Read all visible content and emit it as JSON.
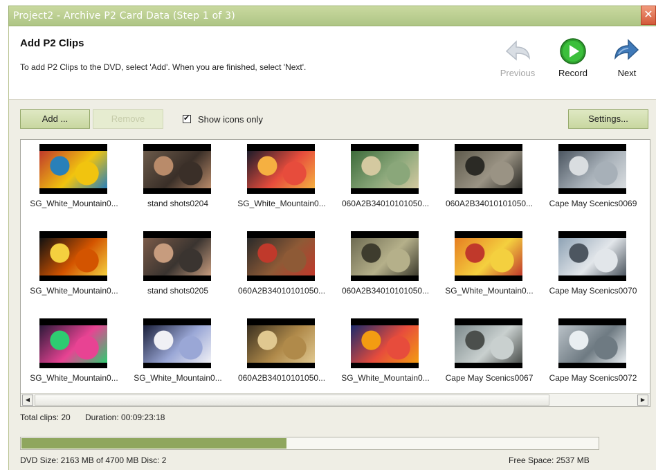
{
  "window": {
    "title": "Project2 - Archive P2 Card Data (Step 1 of 3)",
    "close_glyph": "✕"
  },
  "header": {
    "heading": "Add P2 Clips",
    "instructions": "To add P2 Clips to the DVD, select 'Add'. When you are finished, select 'Next'.",
    "nav": {
      "previous": {
        "label": "Previous",
        "icon": "left-arrow-icon",
        "enabled": false
      },
      "record": {
        "label": "Record",
        "icon": "record-play-icon",
        "enabled": true
      },
      "next": {
        "label": "Next",
        "icon": "right-arrow-icon",
        "enabled": true
      }
    }
  },
  "toolbar": {
    "add_label": "Add ...",
    "remove_label": "Remove",
    "show_icons_label": "Show icons only",
    "show_icons_checked": true,
    "settings_label": "Settings..."
  },
  "clips": [
    {
      "name": "SG_White_Mountain0...",
      "palette": [
        "#c0392b",
        "#f1c40f",
        "#2980b9"
      ]
    },
    {
      "name": "stand shots0204",
      "palette": [
        "#6b5a4a",
        "#3a2f28",
        "#b98b6a"
      ]
    },
    {
      "name": "SG_White_Mountain0...",
      "palette": [
        "#1c1c2a",
        "#e74c3c",
        "#f5b041"
      ]
    },
    {
      "name": "060A2B34010101050...",
      "palette": [
        "#3d6b3a",
        "#8aa77a",
        "#d4c9a0"
      ]
    },
    {
      "name": "060A2B34010101050...",
      "palette": [
        "#5e5a4c",
        "#9a9384",
        "#2b2a25"
      ]
    },
    {
      "name": "Cape May Scenics0069",
      "palette": [
        "#4b5560",
        "#a7b0b8",
        "#d9dde0"
      ]
    },
    {
      "name": "SG_White_Mountain0...",
      "palette": [
        "#111111",
        "#d35400",
        "#f4d03f"
      ]
    },
    {
      "name": "stand shots0205",
      "palette": [
        "#7a5a48",
        "#3a3430",
        "#c79c7e"
      ]
    },
    {
      "name": "060A2B34010101050...",
      "palette": [
        "#2a2a2a",
        "#8e5a36",
        "#c0392b"
      ]
    },
    {
      "name": "060A2B34010101050...",
      "palette": [
        "#6e6b52",
        "#b5b08a",
        "#3e3c2e"
      ]
    },
    {
      "name": "SG_White_Mountain0...",
      "palette": [
        "#e67e22",
        "#f4d03f",
        "#c0392b"
      ]
    },
    {
      "name": "Cape May Scenics0070",
      "palette": [
        "#8fa3b5",
        "#e2e6ea",
        "#4d5660"
      ]
    },
    {
      "name": "SG_White_Mountain0...",
      "palette": [
        "#2c1a3a",
        "#e84393",
        "#2ecc71"
      ]
    },
    {
      "name": "SG_White_Mountain0...",
      "palette": [
        "#1a1f3a",
        "#9aa7d6",
        "#f0f0f5"
      ]
    },
    {
      "name": "060A2B34010101050...",
      "palette": [
        "#3a3020",
        "#b08a4a",
        "#e0c890"
      ]
    },
    {
      "name": "SG_White_Mountain0...",
      "palette": [
        "#1b2a6b",
        "#e74c3c",
        "#f39c12"
      ]
    },
    {
      "name": "Cape May Scenics0067",
      "palette": [
        "#7d8a8c",
        "#c9d0cf",
        "#4b4f4c"
      ]
    },
    {
      "name": "Cape May Scenics0072",
      "palette": [
        "#b9c1c7",
        "#6e7a82",
        "#e9eef1"
      ]
    }
  ],
  "status": {
    "total_clips": "Total clips: 20",
    "duration": "Duration: 00:09:23:18",
    "dvd_size": "DVD Size: 2163 MB of 4700 MB Disc: 2",
    "free_space": "Free Space: 2537 MB",
    "disc_used_fraction": 0.46
  },
  "colors": {
    "accent": "#8fa65e",
    "titlebar": "#aec585",
    "record_green": "#2e9e2e",
    "nav_arrow_blue": "#3f79b8"
  }
}
